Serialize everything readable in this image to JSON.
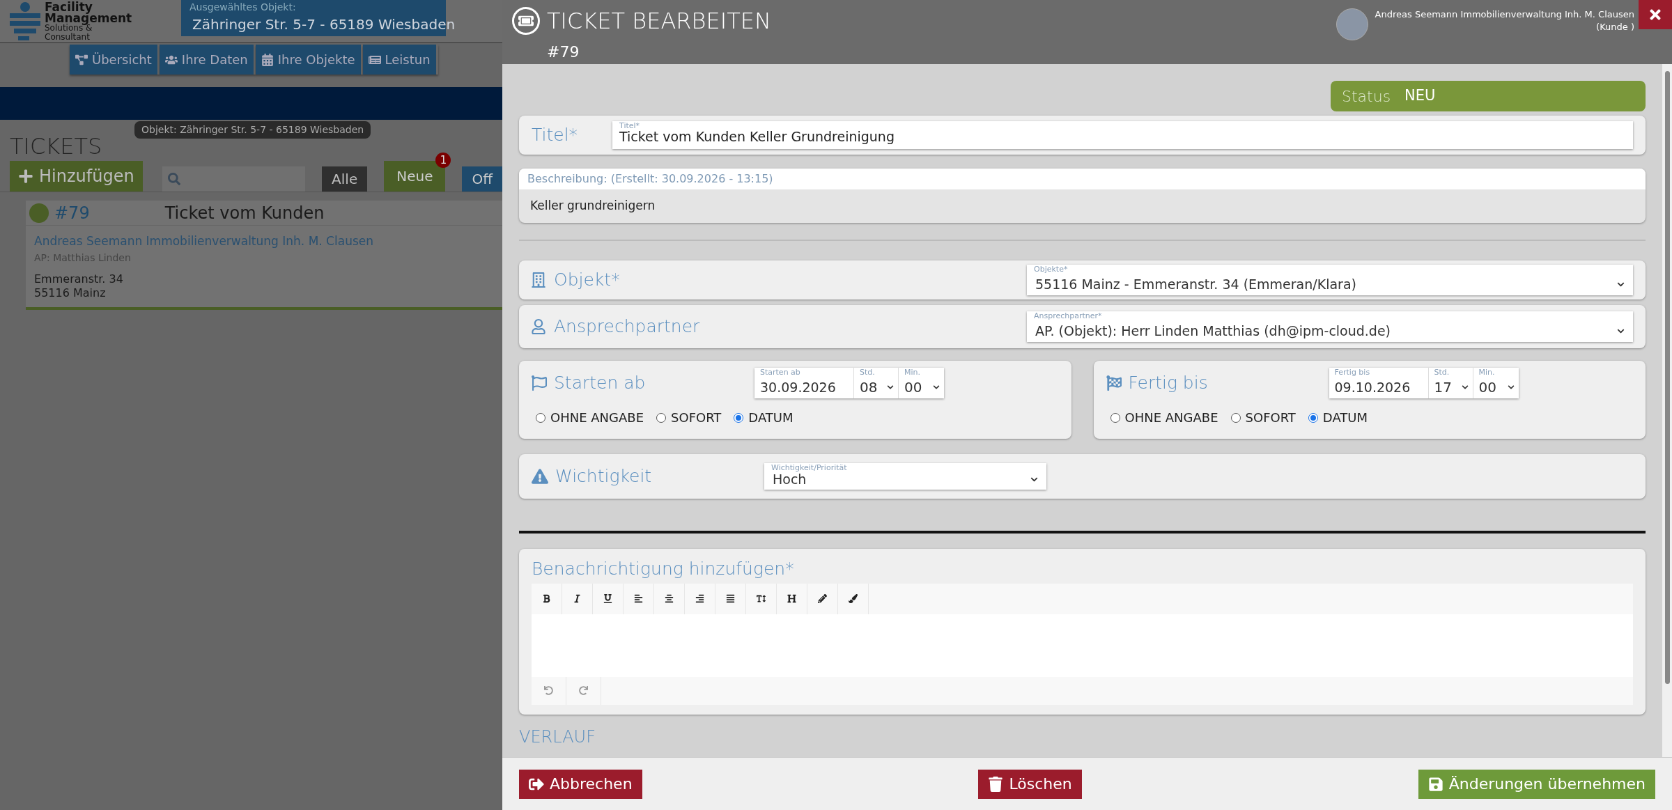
{
  "background_page": {
    "logo": {
      "line_1": "Facility",
      "line_2": "Management",
      "line_3": "Solutions &",
      "line_4": "Consultant"
    },
    "selected_object": {
      "label": "Ausgewähltes Objekt:",
      "value": "Zähringer Str. 5-7 - 65189 Wiesbaden"
    },
    "nav": [
      {
        "label": "Übersicht"
      },
      {
        "label": "Ihre Daten"
      },
      {
        "label": "Ihre Objekte"
      },
      {
        "label": "Leistun"
      }
    ],
    "heading": "TICKETS",
    "tooltip": "Objekt: Zähringer Str. 5-7 - 65189 Wiesbaden",
    "add_button": "Hinzufügen",
    "filters": [
      {
        "label": "Alle",
        "kind": "dark"
      },
      {
        "label": "Neue",
        "kind": "green",
        "badge": "1"
      },
      {
        "label": "Off",
        "kind": "blue"
      }
    ],
    "tickets": [
      {
        "color": "#4a5e26",
        "number": "#79",
        "title": "Ticket vom Kunden",
        "customer": "Andreas Seemann Immobilienverwaltung Inh. M. Clausen",
        "contact": "AP: Matthias Linden",
        "street": "Emmeranstr. 34",
        "city": "55116 Mainz"
      }
    ]
  },
  "dialog": {
    "title": "TICKET BEARBEITEN",
    "number": "#79",
    "user": {
      "name": "Andreas Seemann Immobilienverwaltung Inh. M. Clausen",
      "role": "(Kunde )"
    },
    "status": {
      "label": "Status",
      "value": "NEU"
    },
    "title_field": {
      "label": "Titel*",
      "float_label": "Titel*",
      "value": "Ticket vom Kunden Keller Grundreinigung"
    },
    "description": {
      "header": "Beschreibung: (Erstellt: 30.09.2026 - 13:15)",
      "text": "Keller grundreinigern"
    },
    "object": {
      "label": "Objekt*",
      "float_label": "Objekte*",
      "value": "55116 Mainz - Emmeranstr. 34 (Emmeran/Klara)"
    },
    "contact": {
      "label": "Ansprechpartner",
      "float_label": "Ansprechpartner*",
      "value": "AP. (Objekt): Herr Linden Matthias (dh@ipm-cloud.de)"
    },
    "dates": [
      {
        "kind": "start",
        "label": "Starten ab",
        "date_label": "Starten ab",
        "date": "30.09.2026",
        "hour_label": "Std.",
        "hour": "08",
        "minute_label": "Min.",
        "minute": "00",
        "options": [
          {
            "label": "OHNE ANGABE",
            "selected": false
          },
          {
            "label": "SOFORT",
            "selected": false
          },
          {
            "label": "DATUM",
            "selected": true
          }
        ]
      },
      {
        "kind": "end",
        "label": "Fertig bis",
        "date_label": "Fertig bis",
        "date": "09.10.2026",
        "hour_label": "Std.",
        "hour": "17",
        "minute_label": "Min.",
        "minute": "00",
        "options": [
          {
            "label": "OHNE ANGABE",
            "selected": false
          },
          {
            "label": "SOFORT",
            "selected": false
          },
          {
            "label": "DATUM",
            "selected": true
          }
        ]
      }
    ],
    "priority": {
      "label": "Wichtigkeit",
      "float_label": "Wichtigkeit/Priorität",
      "value": "Hoch"
    },
    "notification": {
      "label": "Benachrichtigung hinzufügen*"
    },
    "history_heading": "VERLAUF",
    "buttons": [
      {
        "kind": "cancel",
        "label": "Abbrechen"
      },
      {
        "kind": "delete",
        "label": "Löschen"
      },
      {
        "kind": "save",
        "label": "Änderungen übernehmen"
      }
    ]
  }
}
